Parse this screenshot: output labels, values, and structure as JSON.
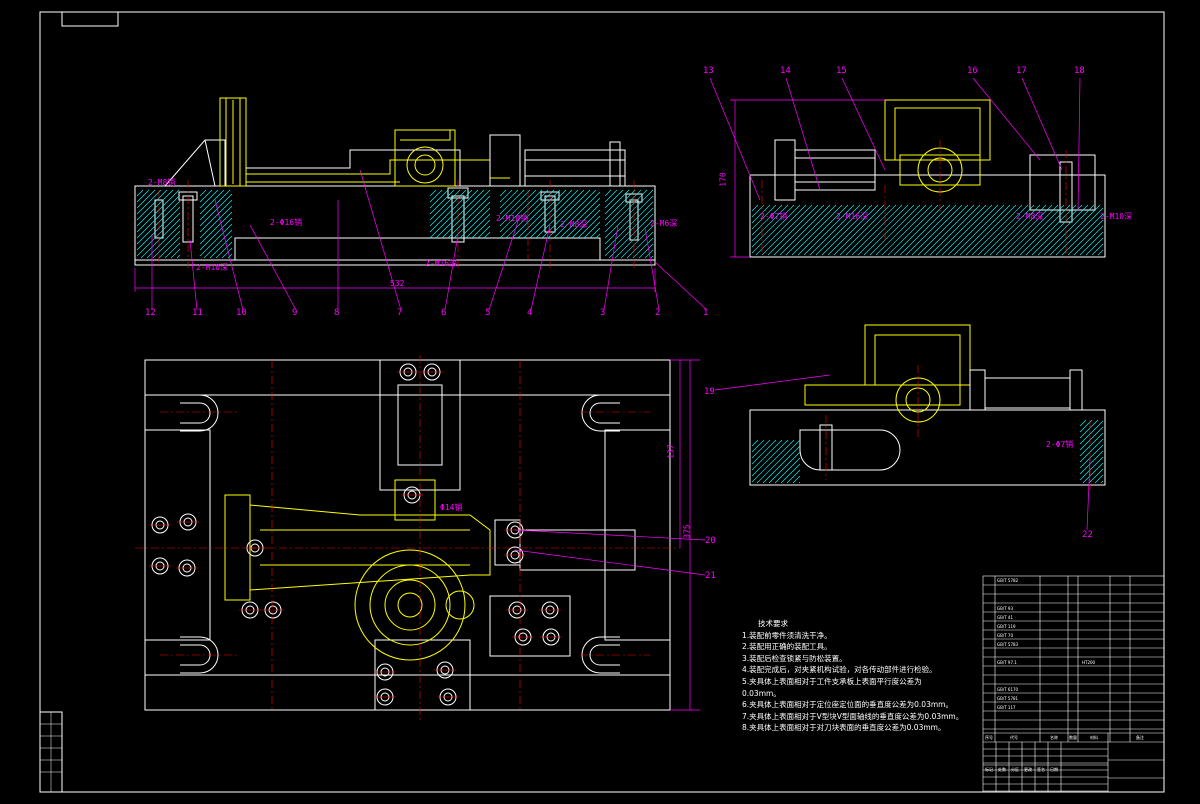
{
  "colors": {
    "background": "#000000",
    "frame": "#ffffff",
    "leader": "#ff00ff",
    "fixture_part": "#ffff00",
    "centerline": "#ff0000",
    "hatch": "#00ffff"
  },
  "part_numbers_front": [
    "12",
    "11",
    "10",
    "9",
    "8",
    "7",
    "6",
    "5",
    "4",
    "3",
    "2",
    "1"
  ],
  "part_numbers_side": [
    "13",
    "14",
    "15",
    "16",
    "17",
    "18"
  ],
  "part_numbers_extra": [
    "19",
    "20",
    "21",
    "22"
  ],
  "dimensions": {
    "front_length": "532",
    "side_height": "170",
    "plan_height_a": "137",
    "plan_height_b": "375"
  },
  "thread_callouts": {
    "front_left": "2-M8销",
    "front_lower_left": "2-M10深",
    "front_mid_left": "2-Φ16销",
    "front_mid": "2-M16深",
    "front_mid_right1": "2-M10销",
    "front_mid_right2": "2-M8深",
    "front_right": "2-M6深",
    "side_left": "2-Φ7销",
    "side_mid": "2-M16深",
    "side_right": "2-M8深",
    "side_far_right": "2-M10深",
    "plan_pin": "Φ14销",
    "end_view": "2-Φ7销"
  },
  "technical_requirements": {
    "heading": "技术要求",
    "items": [
      "1.装配前零件须清洗干净。",
      "2.装配用正确的装配工具。",
      "3.装配后检查锁紧与防松装置。",
      "4.装配完成后，对夹紧机构试验，对各传动部件进行检验。",
      "5.夹具体上表面相对于工件支承板上表面平行度公差为",
      "0.03mm。",
      "6.夹具体上表面相对于定位座定位面的垂直度公差为0.03mm。",
      "7.夹具体上表面相对于V型块V型面轴线的垂直度公差为0.03mm。",
      "8.夹具体上表面相对于对刀块表面的垂直度公差为0.03mm。"
    ]
  },
  "title_block": {
    "header_labels": [
      "序号",
      "代号",
      "名称",
      "数量",
      "材料",
      "备注"
    ],
    "bom_codes": [
      "GB/T 5782",
      "GB/T 93",
      "GB/T 41",
      "GB/T 119",
      "GB/T 70",
      "GB/T 5783",
      "GB/T 97.1",
      "GB/T 6170",
      "GB/T 5781",
      "GB/T 117"
    ],
    "material": "HT200",
    "side_labels": [
      "标记",
      "处数",
      "分区",
      "更改",
      "签名",
      "日期"
    ]
  }
}
